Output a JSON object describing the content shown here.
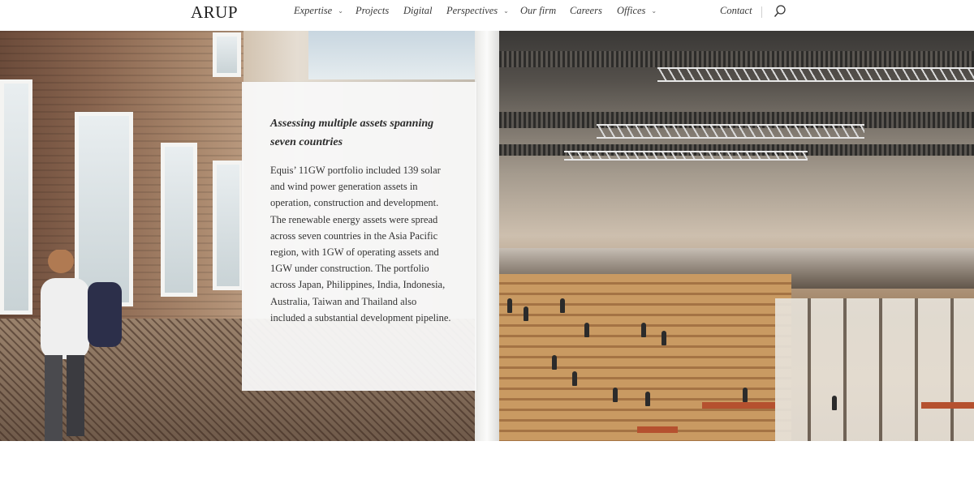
{
  "nav": {
    "logo": "ARUP",
    "items": [
      {
        "label": "Expertise",
        "has_dropdown": true
      },
      {
        "label": "Projects",
        "has_dropdown": false
      },
      {
        "label": "Digital",
        "has_dropdown": false
      },
      {
        "label": "Perspectives",
        "has_dropdown": true
      },
      {
        "label": "Our firm",
        "has_dropdown": false
      },
      {
        "label": "Careers",
        "has_dropdown": false
      },
      {
        "label": "Offices",
        "has_dropdown": true
      }
    ],
    "contact": "Contact",
    "search_icon": "search-icon"
  },
  "hero": {
    "card": {
      "title": "Assessing multiple assets spanning seven countries",
      "body": "Equis’ 11GW portfolio included 139 solar and wind power generation assets in operation, construction and development. The renewable energy assets were spread across seven countries in the Asia Pacific region, with 1GW of operating assets and 1GW under construction. The portfolio across Japan, Philippines, India, Indonesia, Australia, Taiwan and Thailand also included a substantial development pipeline."
    }
  },
  "colors": {
    "text_dark": "#2b2b2b",
    "card_bg": "#f8f8f8",
    "nav_text": "#3a3a3a"
  }
}
